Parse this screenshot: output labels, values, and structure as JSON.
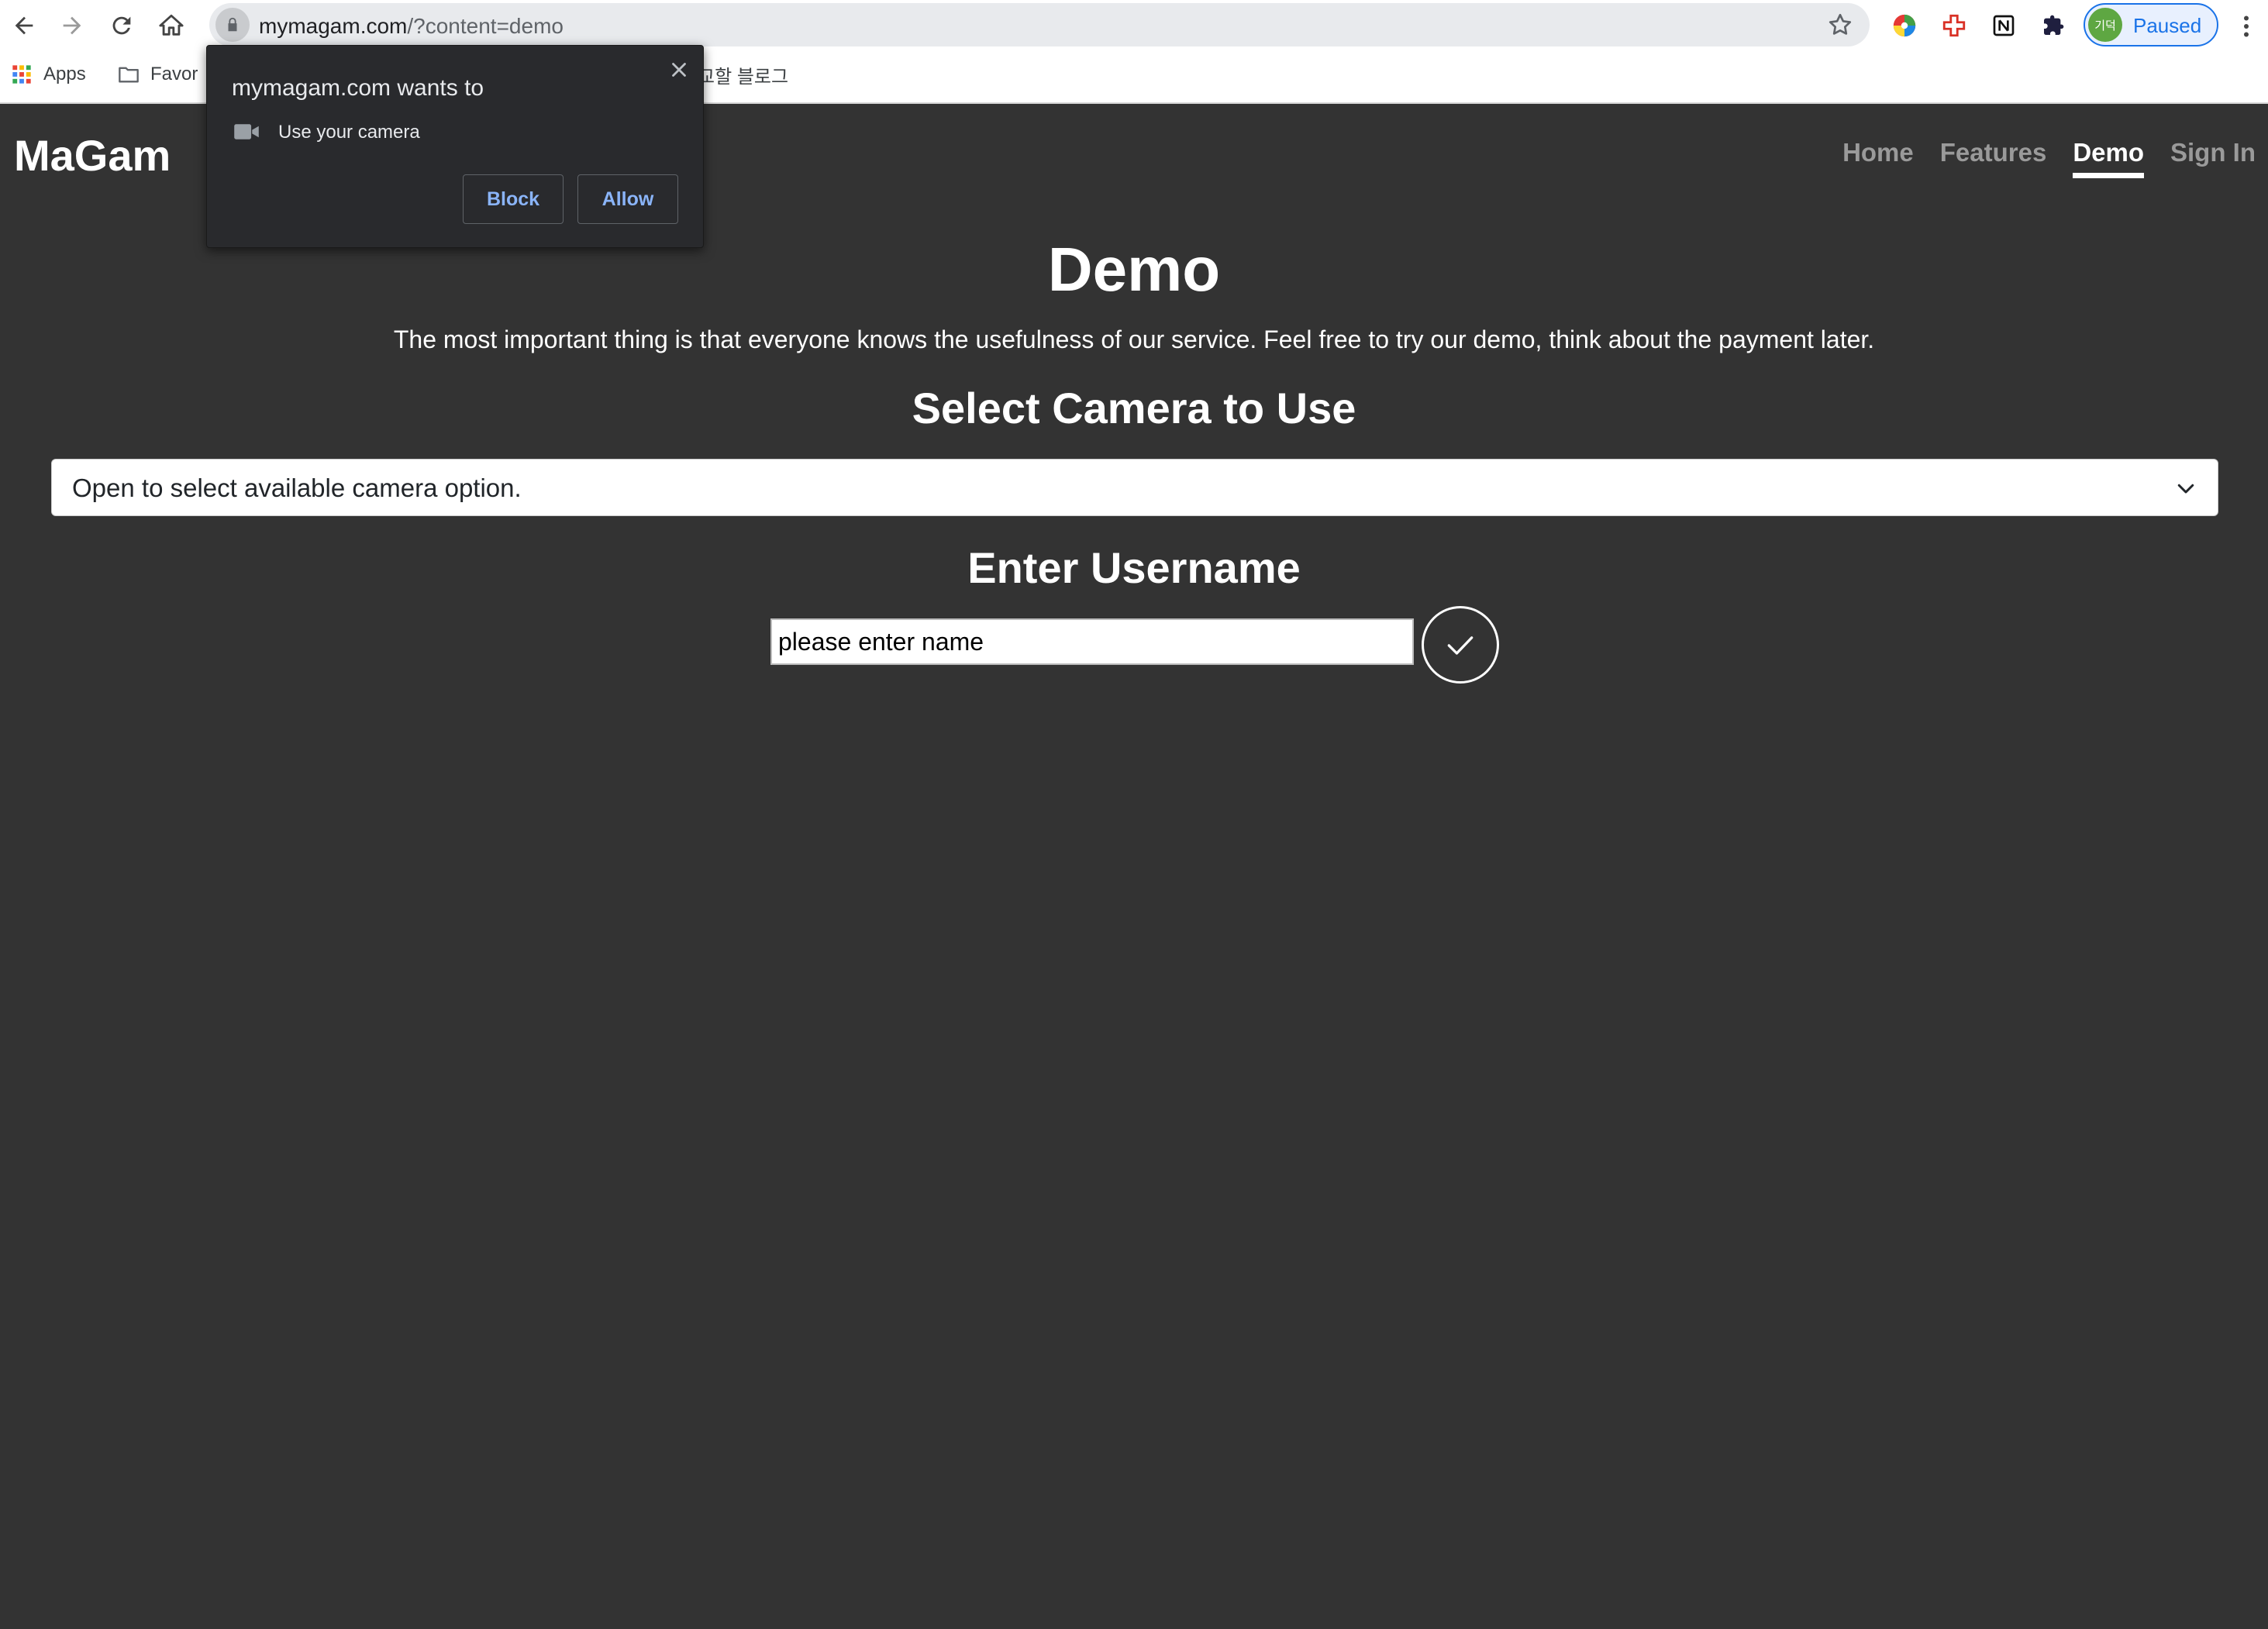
{
  "browser": {
    "url_host": "mymagam.com",
    "url_path": "/?content=demo",
    "profile_avatar_text": "기덕",
    "profile_status": "Paused",
    "bookmarks": [
      {
        "label": "Apps",
        "icon": "apps-grid-icon"
      },
      {
        "label": "Favor",
        "icon": "folder-icon"
      },
      {
        "label": "교할 블로그",
        "icon": ""
      }
    ]
  },
  "permission_popup": {
    "title": "mymagam.com wants to",
    "request": "Use your camera",
    "block_label": "Block",
    "allow_label": "Allow"
  },
  "site": {
    "brand": "MaGam",
    "nav": [
      {
        "label": "Home",
        "active": false
      },
      {
        "label": "Features",
        "active": false
      },
      {
        "label": "Demo",
        "active": true
      },
      {
        "label": "Sign In",
        "active": false
      }
    ]
  },
  "main": {
    "heading": "Demo",
    "lead": "The most important thing is that everyone knows the usefulness of our service. Feel free to try our demo, think about the payment later.",
    "camera_heading": "Select Camera to Use",
    "camera_select_value": "Open to select available camera option.",
    "username_heading": "Enter Username",
    "username_placeholder": "please enter name"
  },
  "colors": {
    "page_bg": "#333333",
    "popup_bg": "#292a2d",
    "popup_button_text": "#8ab4f8",
    "profile_accent": "#1a73e8"
  }
}
